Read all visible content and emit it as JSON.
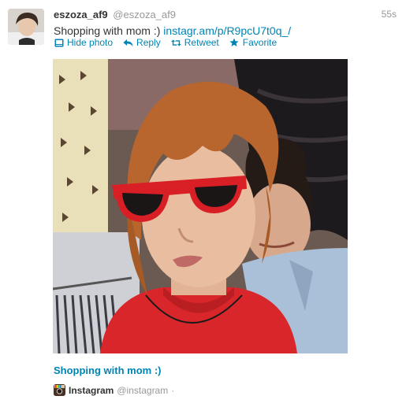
{
  "tweet": {
    "fullname": "eszoza_af9",
    "screenname": "@eszoza_af9",
    "timestamp": "55s",
    "text": "Shopping with mom :) ",
    "link_text": "instagr.am/p/R9pcU7t0q_/"
  },
  "actions": {
    "hide_photo": "Hide photo",
    "reply": "Reply",
    "retweet": "Retweet",
    "favorite": "Favorite"
  },
  "media": {
    "caption": "Shopping with mom :)",
    "source_name": "Instagram",
    "source_handle": "@instagram",
    "source_separator": "·"
  },
  "icons": {
    "hide_photo": "photo-icon",
    "reply": "reply-arrow-icon",
    "retweet": "retweet-icon",
    "favorite": "star-icon",
    "source": "instagram-logo-icon"
  },
  "colors": {
    "link": "#0084b4",
    "muted": "#999999",
    "text": "#333333"
  }
}
